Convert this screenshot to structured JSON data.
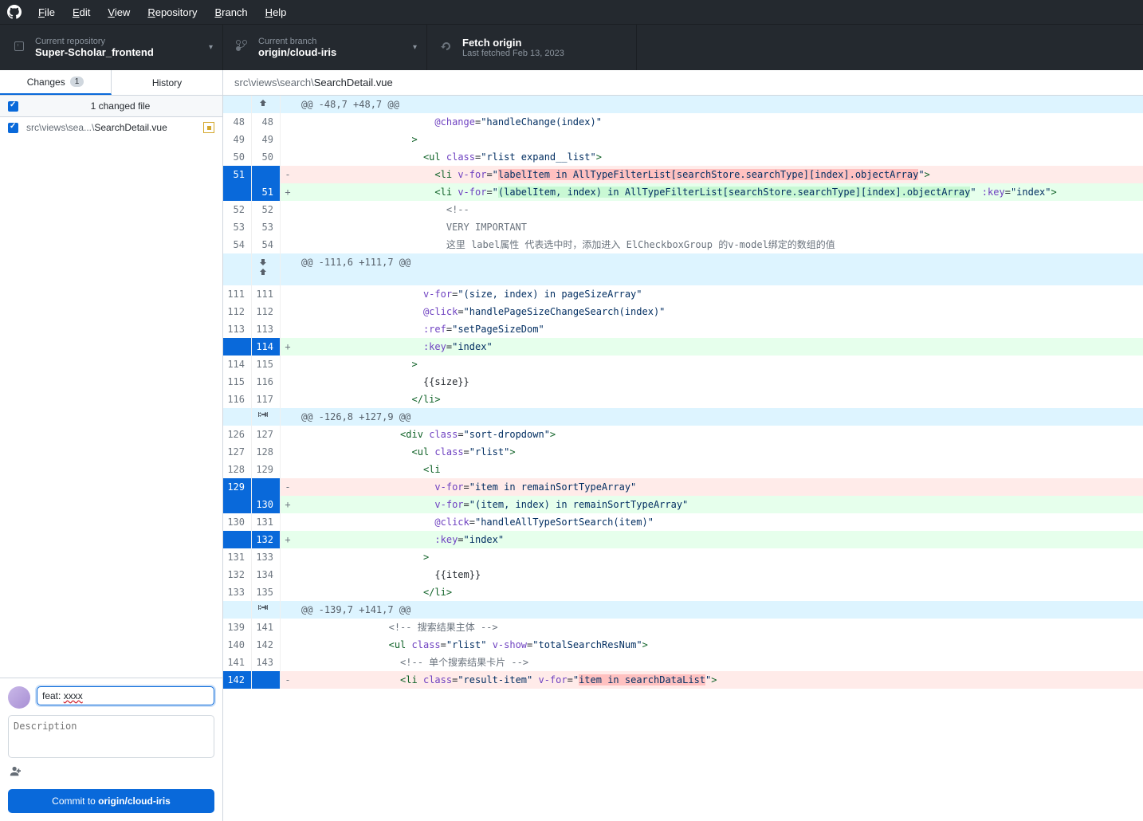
{
  "menubar": {
    "items": [
      {
        "label": "File",
        "key": "F"
      },
      {
        "label": "Edit",
        "key": "E"
      },
      {
        "label": "View",
        "key": "V"
      },
      {
        "label": "Repository",
        "key": "R"
      },
      {
        "label": "Branch",
        "key": "B"
      },
      {
        "label": "Help",
        "key": "H"
      }
    ]
  },
  "toolbar": {
    "repo": {
      "label": "Current repository",
      "value": "Super-Scholar_frontend"
    },
    "branch": {
      "label": "Current branch",
      "value": "origin/cloud-iris"
    },
    "fetch": {
      "label": "Fetch origin",
      "sub": "Last fetched Feb 13, 2023"
    }
  },
  "sidebar": {
    "tabs": {
      "changes": "Changes",
      "changes_count": "1",
      "history": "History"
    },
    "changed_header": "1 changed file",
    "files": [
      {
        "dir": "src\\views\\sea...\\",
        "name": "SearchDetail.vue"
      }
    ],
    "commit": {
      "summary": "feat: xxxx",
      "desc_placeholder": "Description",
      "button_prefix": "Commit to ",
      "button_branch": "origin/cloud-iris"
    }
  },
  "breadcrumb": {
    "dir": "src\\views\\search\\",
    "file": "SearchDetail.vue"
  },
  "diff": {
    "rows": [
      {
        "type": "hunk",
        "text": "@@ -48,7 +48,7 @@",
        "icon": "up"
      },
      {
        "type": "ctx",
        "old": "48",
        "new": "48",
        "html": "                        <span class='pl-attr'>@change</span>=<span class='pl-str'>\"handleChange(index)\"</span>"
      },
      {
        "type": "ctx",
        "old": "49",
        "new": "49",
        "html": "                    <span class='pl-tag'>&gt;</span>"
      },
      {
        "type": "ctx",
        "old": "50",
        "new": "50",
        "html": "                      <span class='pl-tag'>&lt;ul</span> <span class='pl-attr'>class</span>=<span class='pl-str'>\"rlist expand__list\"</span><span class='pl-tag'>&gt;</span>"
      },
      {
        "type": "del",
        "old": "51",
        "new": "",
        "html": "                        <span class='pl-tag'>&lt;li</span> <span class='pl-attr'>v-for</span>=<span class='pl-str'>\"<span class='pl-str-hl'>labelItem in AllTypeFilterList[searchStore.searchType][index].objectArray</span>\"</span><span class='pl-tag'>&gt;</span>"
      },
      {
        "type": "add",
        "old": "",
        "new": "51",
        "html": "                        <span class='pl-tag'>&lt;li</span> <span class='pl-attr'>v-for</span>=<span class='pl-str'>\"<span class='pl-str-hla'>(labelItem, index) in AllTypeFilterList[searchStore.searchType][index].objectArray</span>\"</span> <span class='pl-attr'>:key</span>=<span class='pl-str'>\"index\"</span><span class='pl-tag'>&gt;</span>"
      },
      {
        "type": "ctx",
        "old": "52",
        "new": "52",
        "html": "                          <span class='pl-com'>&lt;!--</span>"
      },
      {
        "type": "ctx",
        "old": "53",
        "new": "53",
        "html": "                          <span class='pl-com'>VERY IMPORTANT</span>"
      },
      {
        "type": "ctx",
        "old": "54",
        "new": "54",
        "html": "                          <span class='pl-com'>这里 label属性 代表选中时，添加进入 ElCheckboxGroup 的v-model绑定的数组的值</span>"
      },
      {
        "type": "hunk",
        "text": "@@ -111,6 +111,7 @@",
        "icon": "both"
      },
      {
        "type": "ctx",
        "old": "111",
        "new": "111",
        "html": "                      <span class='pl-attr'>v-for</span>=<span class='pl-str'>\"(size, index) in pageSizeArray\"</span>"
      },
      {
        "type": "ctx",
        "old": "112",
        "new": "112",
        "html": "                      <span class='pl-attr'>@click</span>=<span class='pl-str'>\"handlePageSizeChangeSearch(index)\"</span>"
      },
      {
        "type": "ctx",
        "old": "113",
        "new": "113",
        "html": "                      <span class='pl-attr'>:ref</span>=<span class='pl-str'>\"setPageSizeDom\"</span>"
      },
      {
        "type": "add",
        "old": "",
        "new": "114",
        "html": "                      <span class='pl-attr'>:key</span>=<span class='pl-str'>\"index\"</span>"
      },
      {
        "type": "ctx",
        "old": "114",
        "new": "115",
        "html": "                    <span class='pl-tag'>&gt;</span>"
      },
      {
        "type": "ctx",
        "old": "115",
        "new": "116",
        "html": "                      {{size}}"
      },
      {
        "type": "ctx",
        "old": "116",
        "new": "117",
        "html": "                    <span class='pl-tag'>&lt;/li&gt;</span>"
      },
      {
        "type": "hunk",
        "text": "@@ -126,8 +127,9 @@",
        "icon": "expand"
      },
      {
        "type": "ctx",
        "old": "126",
        "new": "127",
        "html": "                  <span class='pl-tag'>&lt;div</span> <span class='pl-attr'>class</span>=<span class='pl-str'>\"sort-dropdown\"</span><span class='pl-tag'>&gt;</span>"
      },
      {
        "type": "ctx",
        "old": "127",
        "new": "128",
        "html": "                    <span class='pl-tag'>&lt;ul</span> <span class='pl-attr'>class</span>=<span class='pl-str'>\"rlist\"</span><span class='pl-tag'>&gt;</span>"
      },
      {
        "type": "ctx",
        "old": "128",
        "new": "129",
        "html": "                      <span class='pl-tag'>&lt;li</span>"
      },
      {
        "type": "del",
        "old": "129",
        "new": "",
        "html": "                        <span class='pl-attr'>v-for</span>=<span class='pl-str'>\"item in remainSortTypeArray\"</span>"
      },
      {
        "type": "add",
        "old": "",
        "new": "130",
        "html": "                        <span class='pl-attr'>v-for</span>=<span class='pl-str'>\"(item, index) in remainSortTypeArray\"</span>"
      },
      {
        "type": "ctx",
        "old": "130",
        "new": "131",
        "html": "                        <span class='pl-attr'>@click</span>=<span class='pl-str'>\"handleAllTypeSortSearch(item)\"</span>"
      },
      {
        "type": "add",
        "old": "",
        "new": "132",
        "html": "                        <span class='pl-attr'>:key</span>=<span class='pl-str'>\"index\"</span>"
      },
      {
        "type": "ctx",
        "old": "131",
        "new": "133",
        "html": "                      <span class='pl-tag'>&gt;</span>"
      },
      {
        "type": "ctx",
        "old": "132",
        "new": "134",
        "html": "                        {{item}}"
      },
      {
        "type": "ctx",
        "old": "133",
        "new": "135",
        "html": "                      <span class='pl-tag'>&lt;/li&gt;</span>"
      },
      {
        "type": "hunk",
        "text": "@@ -139,7 +141,7 @@",
        "icon": "expand"
      },
      {
        "type": "ctx",
        "old": "139",
        "new": "141",
        "html": "                <span class='pl-com'>&lt;!-- 搜索结果主体 --&gt;</span>"
      },
      {
        "type": "ctx",
        "old": "140",
        "new": "142",
        "html": "                <span class='pl-tag'>&lt;ul</span> <span class='pl-attr'>class</span>=<span class='pl-str'>\"rlist\"</span> <span class='pl-attr'>v-show</span>=<span class='pl-str'>\"totalSearchResNum\"</span><span class='pl-tag'>&gt;</span>"
      },
      {
        "type": "ctx",
        "old": "141",
        "new": "143",
        "html": "                  <span class='pl-com'>&lt;!-- 单个搜索结果卡片 --&gt;</span>"
      },
      {
        "type": "del",
        "old": "142",
        "new": "",
        "html": "                  <span class='pl-tag'>&lt;li</span> <span class='pl-attr'>class</span>=<span class='pl-str'>\"result-item\"</span> <span class='pl-attr'>v-for</span>=<span class='pl-str'>\"<span class='pl-str-hl'>item in searchDataList</span>\"</span><span class='pl-tag'>&gt;</span>"
      }
    ]
  }
}
